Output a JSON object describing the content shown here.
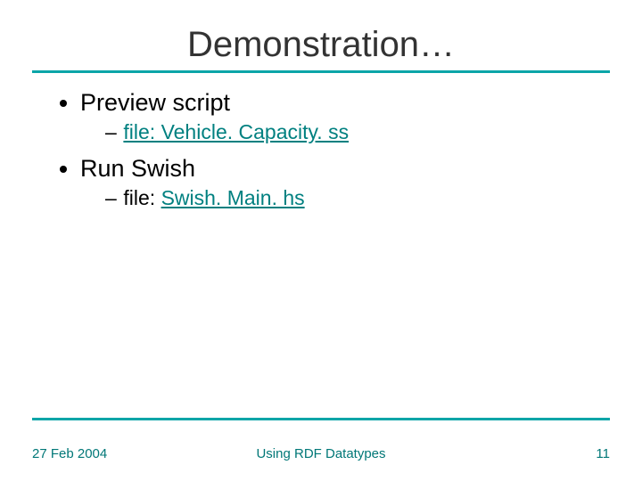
{
  "title": "Demonstration…",
  "bullets": {
    "b1": "Preview script",
    "b1_link": "file: Vehicle. Capacity. ss",
    "b2": "Run Swish",
    "b2_prefix": "file: ",
    "b2_link": "Swish. Main. hs"
  },
  "footer": {
    "date": "27 Feb 2004",
    "mid": "Using RDF Datatypes",
    "num": "11"
  },
  "dash": "–"
}
